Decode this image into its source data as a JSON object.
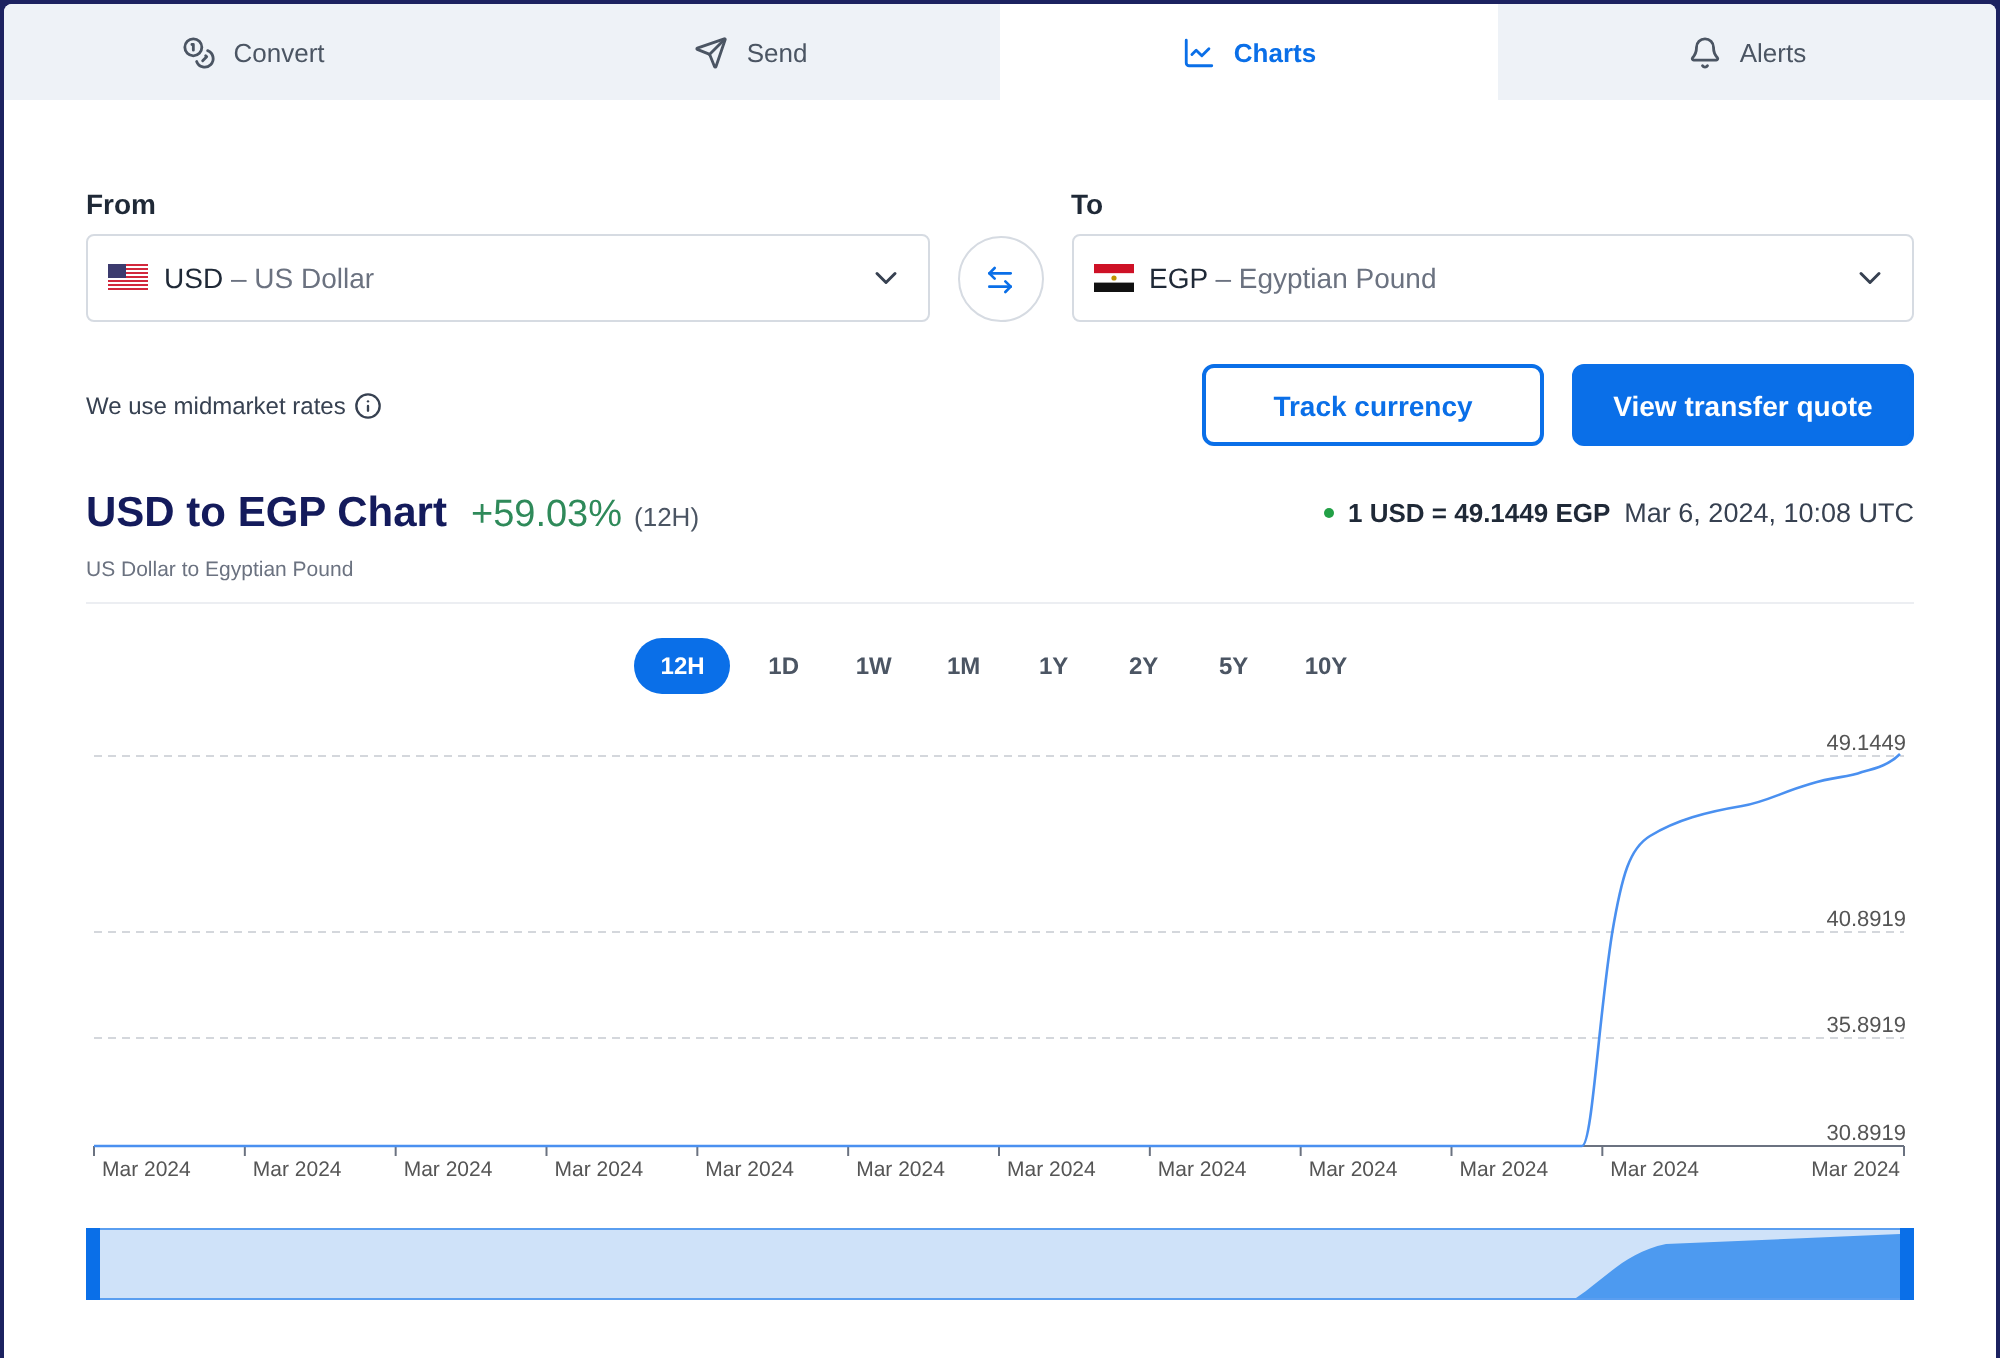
{
  "tabs": [
    {
      "label": "Convert",
      "selected": false
    },
    {
      "label": "Send",
      "selected": false
    },
    {
      "label": "Charts",
      "selected": true
    },
    {
      "label": "Alerts",
      "selected": false
    }
  ],
  "from": {
    "label": "From",
    "code": "USD",
    "name": "– US Dollar"
  },
  "to": {
    "label": "To",
    "code": "EGP",
    "name": "– Egyptian Pound"
  },
  "note": "We use midmarket rates",
  "buttons": [
    {
      "label": "Track currency",
      "kind": "outline"
    },
    {
      "label": "View transfer quote",
      "kind": "primary"
    }
  ],
  "header": {
    "title": "USD to EGP Chart",
    "change": "+59.03%",
    "period": "(12H)",
    "subtitle": "US Dollar to Egyptian Pound",
    "rate": "1 USD = 49.1449 EGP",
    "timestamp": "Mar 6, 2024, 10:08 UTC"
  },
  "ranges": [
    {
      "label": "12H",
      "selected": true
    },
    {
      "label": "1D",
      "selected": false
    },
    {
      "label": "1W",
      "selected": false
    },
    {
      "label": "1M",
      "selected": false
    },
    {
      "label": "1Y",
      "selected": false
    },
    {
      "label": "2Y",
      "selected": false
    },
    {
      "label": "5Y",
      "selected": false
    },
    {
      "label": "10Y",
      "selected": false
    }
  ],
  "chart": {
    "y_labels": [
      "49.1449",
      "40.8919",
      "35.8919",
      "30.8919"
    ],
    "x_labels": [
      "Mar 2024",
      "Mar 2024",
      "Mar 2024",
      "Mar 2024",
      "Mar 2024",
      "Mar 2024",
      "Mar 2024",
      "Mar 2024",
      "Mar 2024",
      "Mar 2024",
      "Mar 2024",
      "Mar 2024"
    ]
  }
}
